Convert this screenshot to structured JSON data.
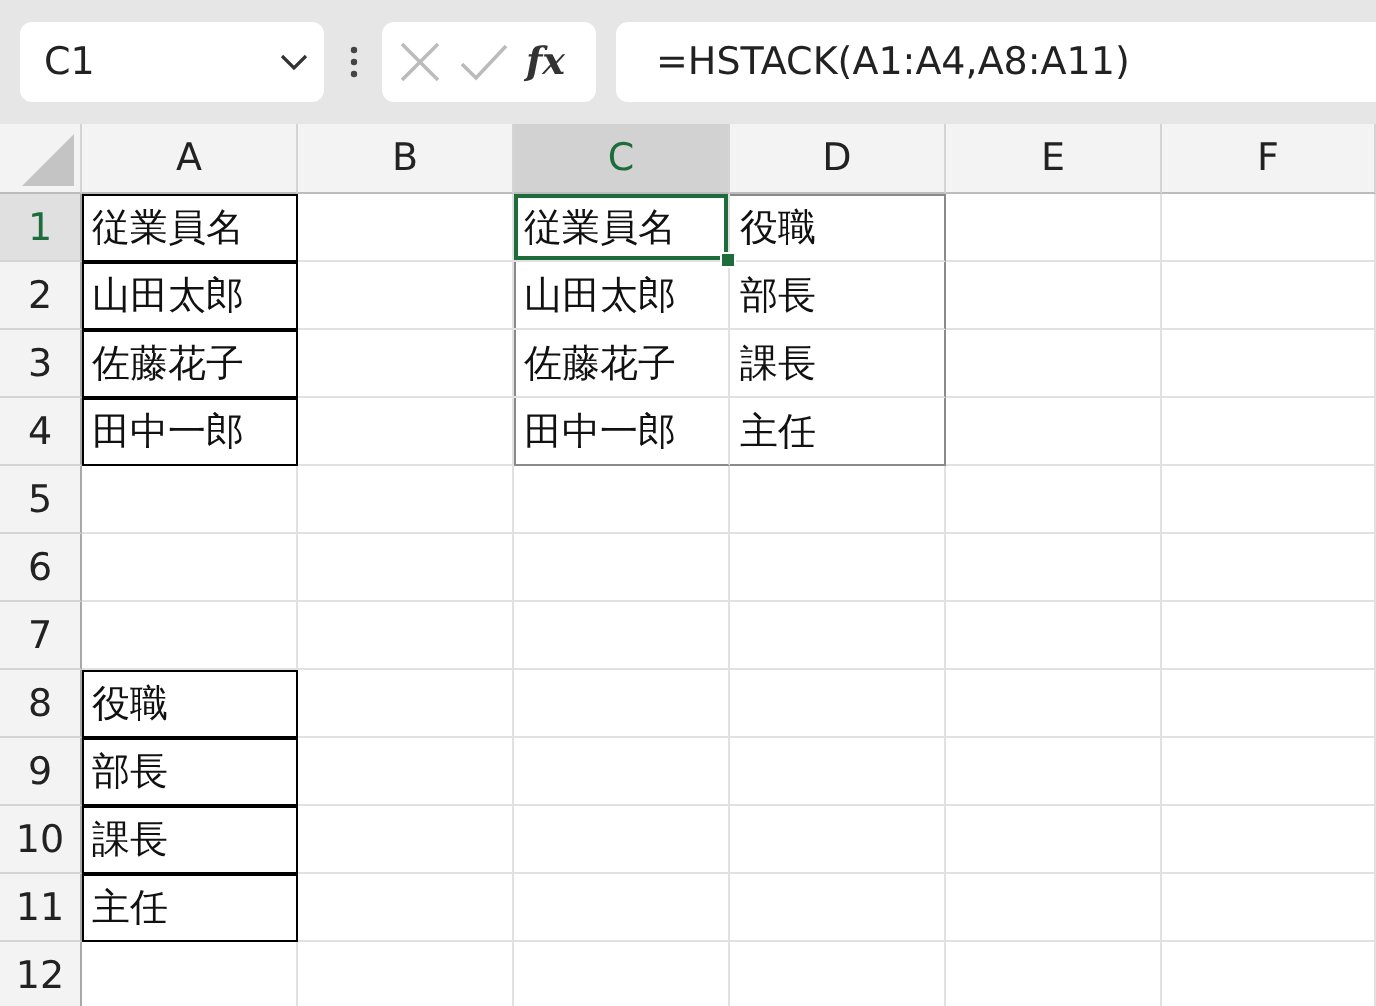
{
  "name_box": {
    "value": "C1"
  },
  "formula_bar": {
    "function_label": "fx",
    "formula": "=HSTACK(A1:A4,A8:A11)"
  },
  "columns": [
    {
      "label": "A",
      "selected": false
    },
    {
      "label": "B",
      "selected": false
    },
    {
      "label": "C",
      "selected": true
    },
    {
      "label": "D",
      "selected": false
    },
    {
      "label": "E",
      "selected": false
    },
    {
      "label": "F",
      "selected": false
    }
  ],
  "rows": [
    {
      "label": "1",
      "selected": true,
      "cells": [
        {
          "kind": "bordered",
          "text": "従業員名",
          "active": false
        },
        {
          "kind": "plain",
          "active": false
        },
        {
          "kind": "spill",
          "text": "従業員名",
          "active": true
        },
        {
          "kind": "spill",
          "text": "役職",
          "active": false
        }
      ]
    },
    {
      "label": "2",
      "selected": false,
      "cells": [
        {
          "kind": "bordered",
          "text": "山田太郎",
          "active": false
        },
        {
          "kind": "plain",
          "active": false
        },
        {
          "kind": "spill",
          "text": "山田太郎",
          "active": false
        },
        {
          "kind": "spill",
          "text": "部長",
          "active": false
        }
      ]
    },
    {
      "label": "3",
      "selected": false,
      "cells": [
        {
          "kind": "bordered",
          "text": "佐藤花子",
          "active": false
        },
        {
          "kind": "plain",
          "active": false
        },
        {
          "kind": "spill",
          "text": "佐藤花子",
          "active": false
        },
        {
          "kind": "spill",
          "text": "課長",
          "active": false
        }
      ]
    },
    {
      "label": "4",
      "selected": false,
      "cells": [
        {
          "kind": "bordered",
          "text": "田中一郎",
          "active": false
        },
        {
          "kind": "plain",
          "active": false
        },
        {
          "kind": "spill",
          "text": "田中一郎",
          "active": false
        },
        {
          "kind": "spill",
          "text": "主任",
          "active": false
        }
      ]
    },
    {
      "label": "5",
      "selected": false,
      "cells": []
    },
    {
      "label": "6",
      "selected": false,
      "cells": []
    },
    {
      "label": "7",
      "selected": false,
      "cells": []
    },
    {
      "label": "8",
      "selected": false,
      "cells": [
        {
          "kind": "bordered",
          "text": "役職",
          "active": false
        }
      ]
    },
    {
      "label": "9",
      "selected": false,
      "cells": [
        {
          "kind": "bordered",
          "text": "部長",
          "active": false
        }
      ]
    },
    {
      "label": "10",
      "selected": false,
      "cells": [
        {
          "kind": "bordered",
          "text": "課長",
          "active": false
        }
      ]
    },
    {
      "label": "11",
      "selected": false,
      "cells": [
        {
          "kind": "bordered",
          "text": "主任",
          "active": false
        }
      ]
    },
    {
      "label": "12",
      "selected": false,
      "cells": []
    }
  ]
}
